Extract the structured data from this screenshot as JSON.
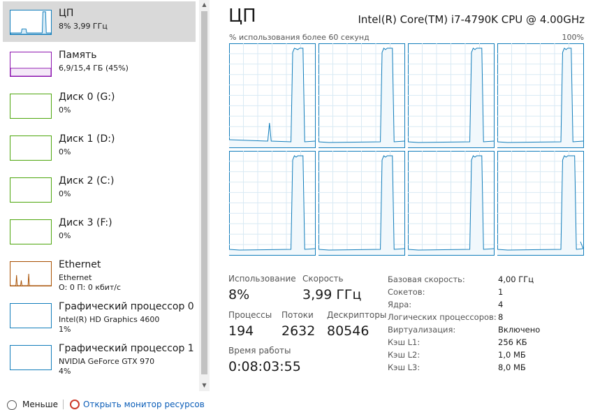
{
  "sidebar": {
    "items": [
      {
        "name": "ЦП",
        "sub1": "8% 3,99 ГГц",
        "sub2": "",
        "color": "#117dbb",
        "selected": true
      },
      {
        "name": "Память",
        "sub1": "6,9/15,4 ГБ (45%)",
        "sub2": "",
        "color": "#8b12ae",
        "selected": false
      },
      {
        "name": "Диск 0 (G:)",
        "sub1": "0%",
        "sub2": "",
        "color": "#4da60c",
        "selected": false
      },
      {
        "name": "Диск 1 (D:)",
        "sub1": "0%",
        "sub2": "",
        "color": "#4da60c",
        "selected": false
      },
      {
        "name": "Диск 2 (C:)",
        "sub1": "0%",
        "sub2": "",
        "color": "#4da60c",
        "selected": false
      },
      {
        "name": "Диск 3 (F:)",
        "sub1": "0%",
        "sub2": "",
        "color": "#4da60c",
        "selected": false
      },
      {
        "name": "Ethernet",
        "sub1": "Ethernet",
        "sub2": "О: 0 П: 0 кбит/с",
        "color": "#a74f01",
        "selected": false
      },
      {
        "name": "Графический процессор 0",
        "sub1": "Intel(R) HD Graphics 4600",
        "sub2": "1%",
        "color": "#117dbb",
        "selected": false
      },
      {
        "name": "Графический процессор 1",
        "sub1": "NVIDIA GeForce GTX 970",
        "sub2": "4%",
        "color": "#117dbb",
        "selected": false
      }
    ]
  },
  "cpu": {
    "title": "ЦП",
    "model": "Intel(R) Core(TM) i7-4790K CPU @ 4.00GHz",
    "graph_label": "% использования более 60 секунд",
    "graph_max": "100%",
    "accent": "#117dbb",
    "stats": {
      "util_label": "Использование",
      "util_value": "8%",
      "speed_label": "Скорость",
      "speed_value": "3,99 ГГц",
      "proc_label": "Процессы",
      "proc_value": "194",
      "threads_label": "Потоки",
      "threads_value": "2632",
      "handles_label": "Дескрипторы",
      "handles_value": "80546",
      "uptime_label": "Время работы",
      "uptime_value": "0:08:03:55"
    },
    "specs": [
      {
        "key": "Базовая скорость:",
        "value": "4,00 ГГц"
      },
      {
        "key": "Сокетов:",
        "value": "1"
      },
      {
        "key": "Ядра:",
        "value": "4"
      },
      {
        "key": "Логических процессоров:",
        "value": "8"
      },
      {
        "key": "Виртуализация:",
        "value": "Включено"
      },
      {
        "key": "Кэш L1:",
        "value": "256 КБ"
      },
      {
        "key": "Кэш L2:",
        "value": "1,0 МБ"
      },
      {
        "key": "Кэш L3:",
        "value": "8,0 МБ"
      }
    ]
  },
  "footer": {
    "less_label": "Меньше",
    "monitor_link": "Открыть монитор ресурсов"
  }
}
